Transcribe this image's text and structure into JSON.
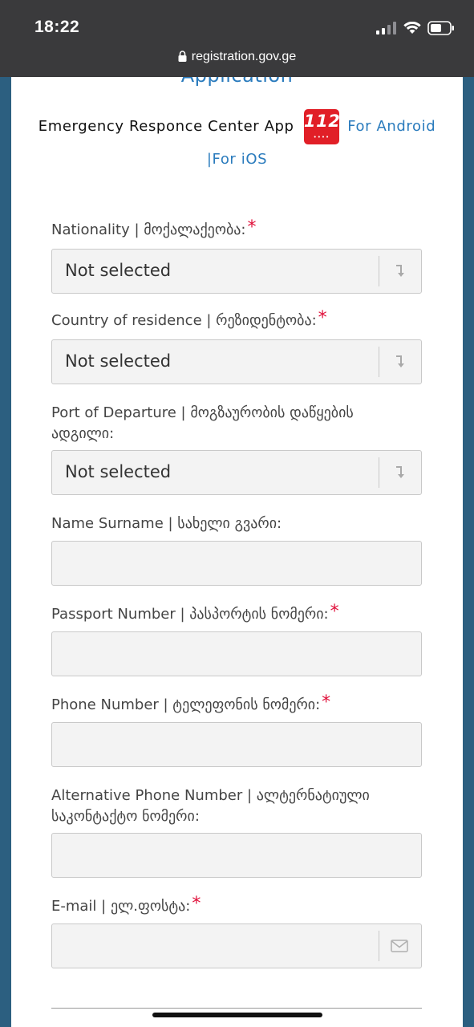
{
  "status_bar": {
    "time": "18:22",
    "url": "registration.gov.ge"
  },
  "header": {
    "app_heading": "Application",
    "erc_text": "Emergency Responce Center App",
    "badge_number": "112",
    "badge_dots": "••••",
    "android_link": "For Android",
    "ios_link": "|For iOS"
  },
  "form": {
    "nationality": {
      "label": "Nationality | მოქალაქეობა:",
      "value": "Not selected",
      "required": "*"
    },
    "residence": {
      "label": "Country of residence | რეზიდენტობა:",
      "value": "Not selected",
      "required": "*"
    },
    "departure": {
      "label": "Port of Departure | მოგზაურობის დაწყების ადგილი:",
      "value": "Not selected"
    },
    "name": {
      "label": "Name Surname | სახელი გვარი:",
      "value": ""
    },
    "passport": {
      "label": "Passport Number | პასპორტის ნომერი:",
      "value": "",
      "required": "*"
    },
    "phone": {
      "label": "Phone Number | ტელეფონის ნომერი:",
      "value": "",
      "required": "*"
    },
    "alt_phone": {
      "label": "Alternative Phone Number | ალტერნატიული საკონტაქტო ნომერი:",
      "value": ""
    },
    "email": {
      "label": "E-mail | ელ.ფოსტა:",
      "value": "",
      "required": "*"
    }
  },
  "colors": {
    "link": "#2a7bbd",
    "required": "#e0103a",
    "badge": "#e11f27",
    "status_bar": "#3a3a3c",
    "page_bg": "#2c5f80"
  }
}
